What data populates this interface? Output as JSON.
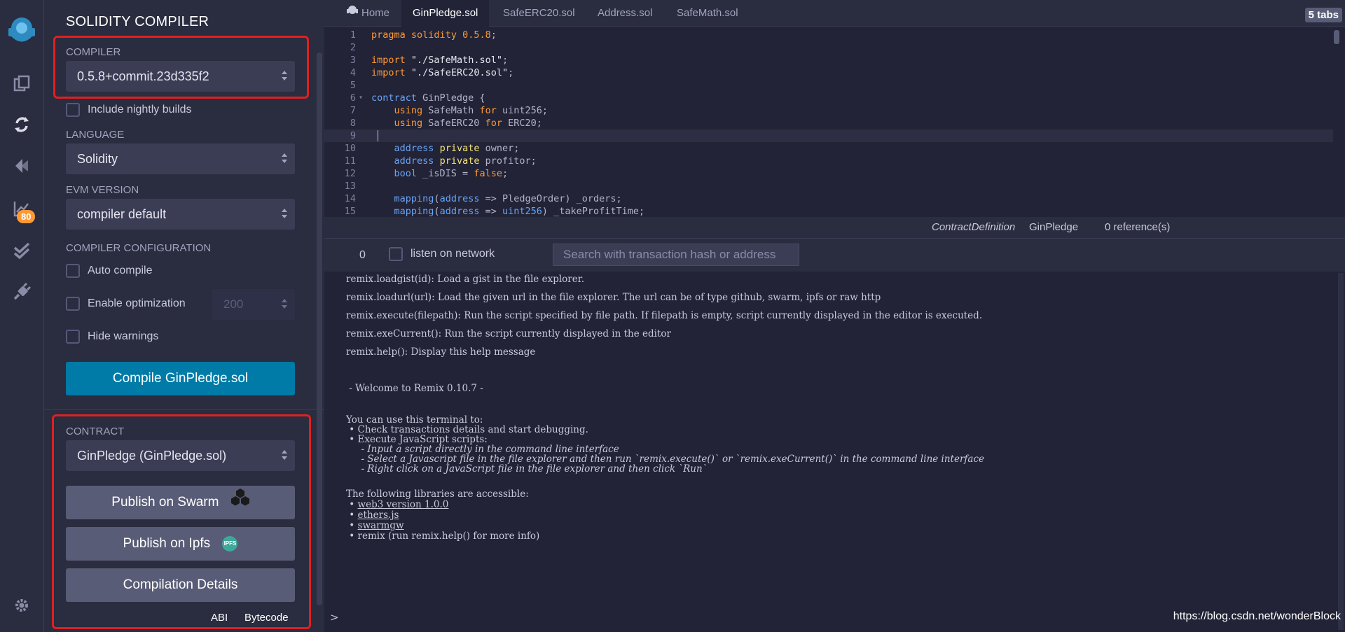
{
  "rail": {
    "badge": "80",
    "icons": [
      "remix-logo-icon",
      "file-explorer-icon",
      "solidity-compiler-icon",
      "deploy-run-icon",
      "analysis-icon",
      "test-icon",
      "plugin-manager-icon",
      "settings-icon"
    ]
  },
  "panel": {
    "title": "SOLIDITY COMPILER",
    "compiler_label": "COMPILER",
    "compiler_value": "0.5.8+commit.23d335f2",
    "nightly_label": "Include nightly builds",
    "language_label": "LANGUAGE",
    "language_value": "Solidity",
    "evm_label": "EVM VERSION",
    "evm_value": "compiler default",
    "config_label": "COMPILER CONFIGURATION",
    "auto_compile": "Auto compile",
    "enable_optimization": "Enable optimization",
    "runs_value": "200",
    "hide_warnings": "Hide warnings",
    "compile_button": "Compile GinPledge.sol",
    "contract_label": "CONTRACT",
    "contract_value": "GinPledge (GinPledge.sol)",
    "publish_swarm": "Publish on Swarm",
    "publish_ipfs": "Publish on Ipfs",
    "ipfs_badge": "IPFS",
    "compilation_details": "Compilation Details",
    "abi": "ABI",
    "bytecode": "Bytecode"
  },
  "tabs": {
    "home": "Home",
    "files": [
      "GinPledge.sol",
      "SafeERC20.sol",
      "Address.sol",
      "SafeMath.sol"
    ],
    "active": "GinPledge.sol",
    "count": "5 tabs"
  },
  "editor": {
    "line_numbers": [
      "1",
      "2",
      "3",
      "4",
      "5",
      "6",
      "7",
      "8",
      "9",
      "10",
      "11",
      "12",
      "13",
      "14",
      "15"
    ],
    "current_line": 9
  },
  "context": {
    "type": "ContractDefinition",
    "name": "GinPledge",
    "references": "0 reference(s)"
  },
  "terminal_bar": {
    "count": "0",
    "listen_label": "listen on network",
    "search_placeholder": "Search with transaction hash or address"
  },
  "terminal": {
    "help_lines": [
      {
        "cmd": "remix.loadgist(id)",
        "desc": ": Load a gist in the file explorer."
      },
      {
        "cmd": "remix.loadurl(url)",
        "desc": ": Load the given url in the file explorer. The url can be of type github, swarm, ipfs or raw http"
      },
      {
        "cmd": "remix.execute(filepath)",
        "desc": ": Run the script specified by file path. If filepath is empty, script currently displayed in the editor is executed."
      },
      {
        "cmd": "remix.exeCurrent()",
        "desc": ": Run the script currently displayed in the editor"
      },
      {
        "cmd": "remix.help()",
        "desc": ": Display this help message"
      }
    ],
    "welcome": " - Welcome to Remix 0.10.7 -",
    "use_intro": "You can use this terminal to:",
    "use_items": [
      " • Check transactions details and start debugging.",
      " • Execute JavaScript scripts:"
    ],
    "sub_items": [
      "     - Input a script directly in the command line interface",
      "     - Select a Javascript file in the file explorer and then run `remix.execute()` or `remix.exeCurrent()` in the command line interface",
      "     - Right click on a JavaScript file in the file explorer and then click `Run`"
    ],
    "libs_intro": "The following libraries are accessible:",
    "libs": [
      "web3 version 1.0.0",
      "ethers.js",
      "swarmgw"
    ],
    "libs_last": "remix (run remix.help() for more info)",
    "prompt": ">",
    "watermark": "https://blog.csdn.net/wonderBlock"
  }
}
